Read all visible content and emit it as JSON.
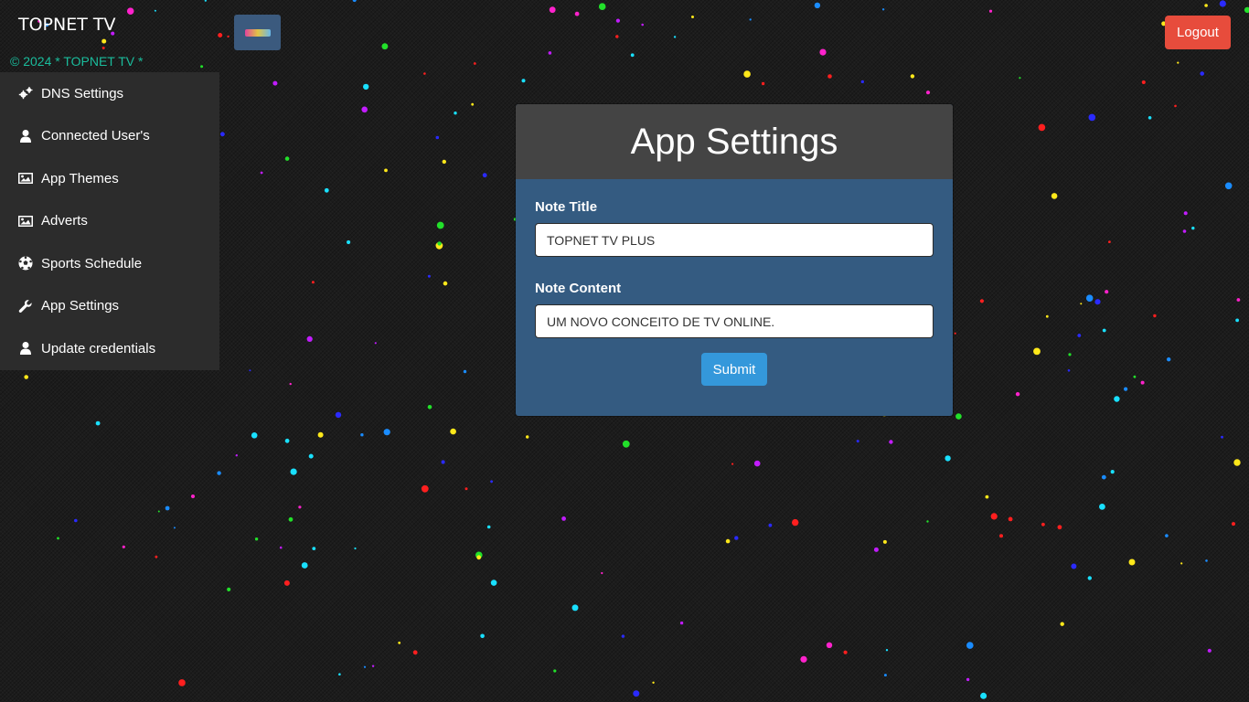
{
  "header": {
    "brand": "TOPNET TV",
    "logout_label": "Logout",
    "copyright": "© 2024 * TOPNET TV *",
    "logo_icon": "topnet-logo"
  },
  "sidebar": {
    "items": [
      {
        "label": "DNS Settings",
        "icon": "gears-icon"
      },
      {
        "label": "Connected User's",
        "icon": "user-icon"
      },
      {
        "label": "App Themes",
        "icon": "image-icon"
      },
      {
        "label": "Adverts",
        "icon": "image-icon"
      },
      {
        "label": "Sports Schedule",
        "icon": "soccer-ball-icon"
      },
      {
        "label": "App Settings",
        "icon": "wrench-icon"
      },
      {
        "label": "Update credentials",
        "icon": "user-icon"
      }
    ]
  },
  "main": {
    "title": "App Settings",
    "fields": [
      {
        "label": "Note Title",
        "value": "TOPNET TV PLUS"
      },
      {
        "label": "Note Content",
        "value": "UM NOVO CONCEITO DE TV ONLINE."
      }
    ],
    "submit_label": "Submit"
  },
  "colors": {
    "background": "#1c1c1c",
    "sidebar": "#2c2c2c",
    "card_header": "#444444",
    "card_body": "#345b81",
    "logout": "#e74c3c",
    "submit": "#3498db",
    "copyright": "#1abc9c"
  }
}
